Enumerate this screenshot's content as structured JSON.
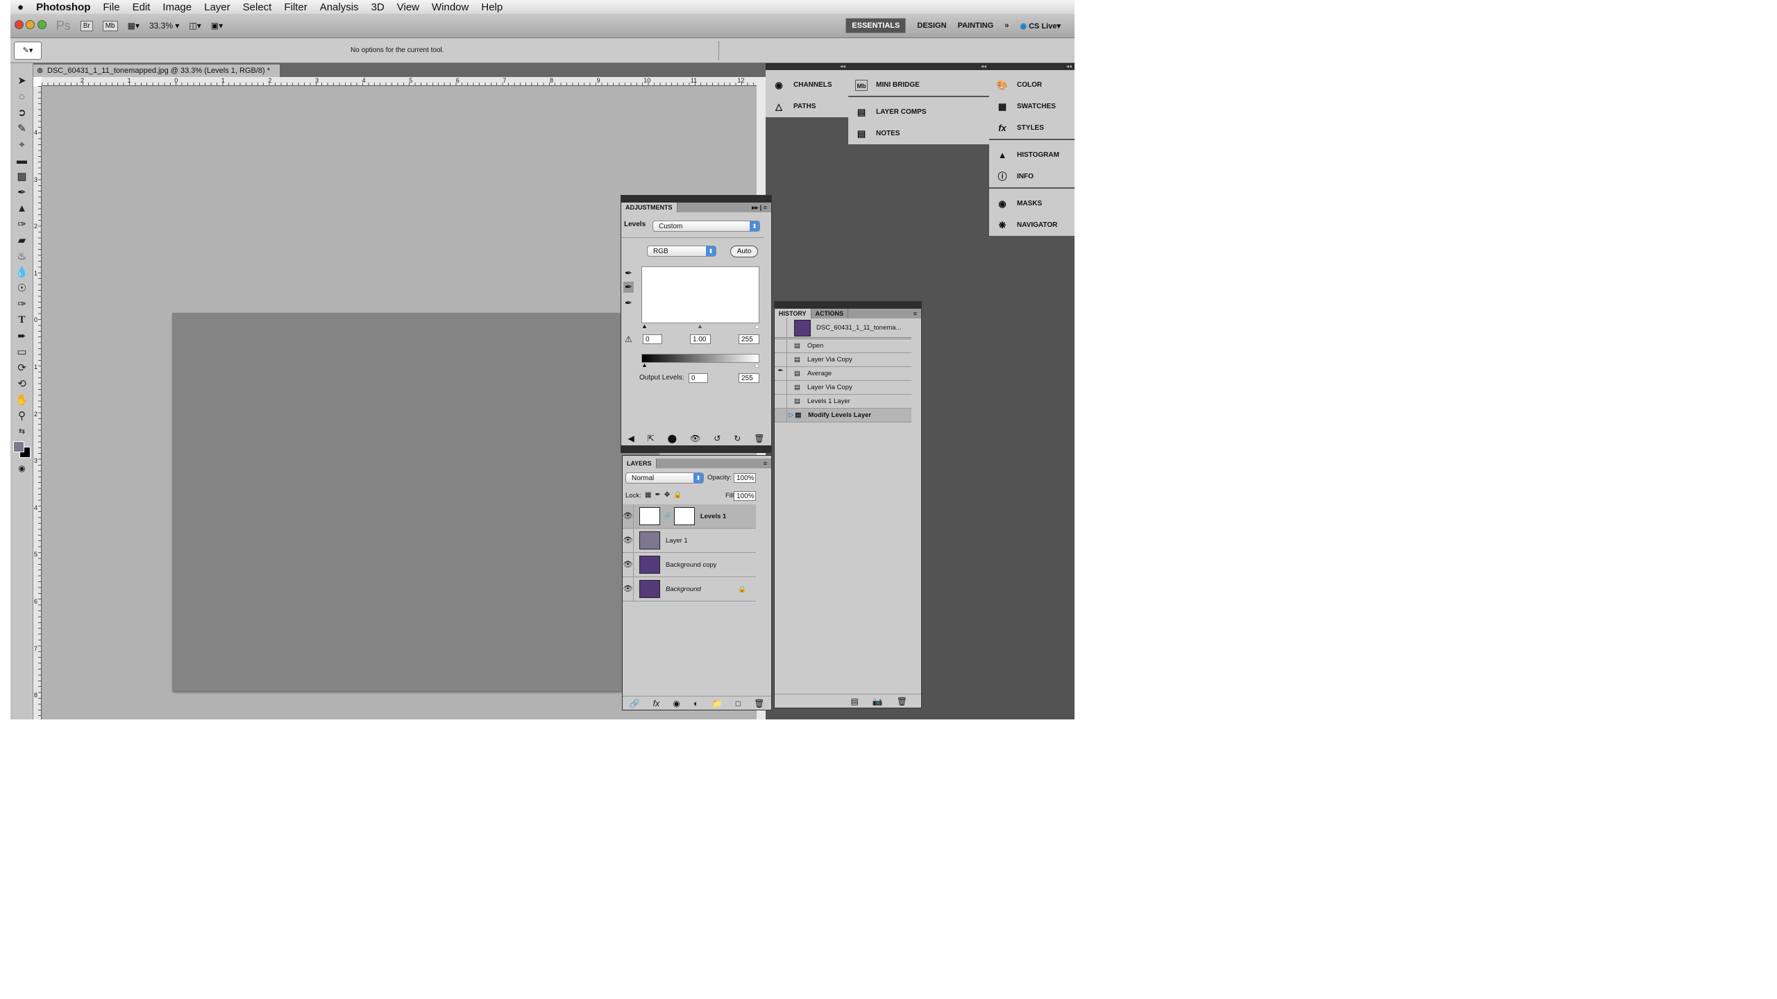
{
  "menubar": {
    "apple": "",
    "app": "Photoshop",
    "items": [
      "File",
      "Edit",
      "Image",
      "Layer",
      "Select",
      "Filter",
      "Analysis",
      "3D",
      "View",
      "Window",
      "Help"
    ]
  },
  "appbar": {
    "ps_logo": "Ps",
    "br": "Br",
    "mb": "Mb",
    "zoom": "33.3%",
    "workspaces": [
      "ESSENTIALS",
      "DESIGN",
      "PAINTING"
    ],
    "more": "»",
    "cs_live": "CS Live"
  },
  "options": {
    "text": "No options for the current tool."
  },
  "document": {
    "tab_title": "DSC_60431_1_11_tonemapped.jpg @ 33.3% (Levels 1, RGB/8) *",
    "h_ruler": [
      "2",
      "1",
      "0",
      "1",
      "2",
      "3",
      "4",
      "5",
      "6",
      "7",
      "8",
      "9",
      "10",
      "11",
      "12"
    ],
    "v_ruler": [
      "4",
      "3",
      "2",
      "1",
      "0",
      "1",
      "2",
      "3",
      "4",
      "5",
      "6",
      "7",
      "8"
    ],
    "image_color": "#848484"
  },
  "dock": {
    "col1": [
      "CHANNELS",
      "PATHS"
    ],
    "col2a": [
      "MINI BRIDGE"
    ],
    "col2b": [
      "LAYER COMPS",
      "NOTES"
    ],
    "col3a": [
      "COLOR",
      "SWATCHES",
      "STYLES"
    ],
    "col3b": [
      "HISTOGRAM",
      "INFO"
    ],
    "col3c": [
      "MASKS",
      "NAVIGATOR"
    ]
  },
  "adjustments": {
    "tab": "ADJUSTMENTS",
    "type_label": "Levels",
    "preset": "Custom",
    "channel": "RGB",
    "auto": "Auto",
    "input_black": "0",
    "input_gamma": "1.00",
    "input_white": "255",
    "output_label": "Output Levels:",
    "output_black": "0",
    "output_white": "255"
  },
  "history": {
    "tabs": [
      "HISTORY",
      "ACTIONS"
    ],
    "snapshot": "DSC_60431_1_11_tonema...",
    "steps": [
      "Open",
      "Layer Via Copy",
      "Average",
      "Layer Via Copy",
      "Levels 1 Layer",
      "Modify Levels Layer"
    ],
    "active_step": "Modify Levels Layer"
  },
  "layers": {
    "tab": "LAYERS",
    "blend": "Normal",
    "opacity_label": "Opacity:",
    "opacity": "100%",
    "lock_label": "Lock:",
    "fill_label": "Fill:",
    "fill": "100%",
    "items": [
      {
        "name": "Levels 1",
        "selected": true
      },
      {
        "name": "Layer 1",
        "color": "#7d7890"
      },
      {
        "name": "Background copy"
      },
      {
        "name": "Background",
        "locked": true
      }
    ]
  }
}
